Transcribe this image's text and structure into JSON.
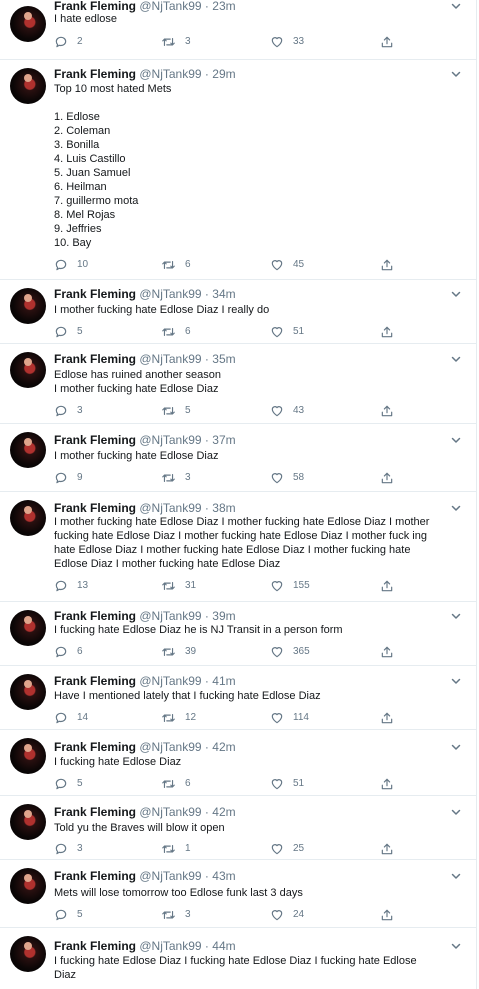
{
  "tweets": [
    {
      "name": "Frank Fleming",
      "handle": "@NjTank99",
      "sep": "·",
      "time": "23m",
      "text": "I hate edlose",
      "replies": "2",
      "retweets": "3",
      "likes": "33"
    },
    {
      "name": "Frank Fleming",
      "handle": "@NjTank99",
      "sep": "·",
      "time": "29m",
      "text": "Top 10 most hated Mets\n\n1. Edlose\n2. Coleman\n3. Bonilla\n4. Luis Castillo\n5. Juan Samuel\n6. Heilman\n7. guillermo mota\n8. Mel Rojas\n9. Jeffries\n10. Bay",
      "replies": "10",
      "retweets": "6",
      "likes": "45"
    },
    {
      "name": "Frank Fleming",
      "handle": "@NjTank99",
      "sep": "·",
      "time": "34m",
      "text": "I mother fucking hate Edlose Diaz I really do",
      "replies": "5",
      "retweets": "6",
      "likes": "51"
    },
    {
      "name": "Frank Fleming",
      "handle": "@NjTank99",
      "sep": "·",
      "time": "35m",
      "text": "Edlose has ruined another season\nI mother fucking hate Edlose Diaz",
      "replies": "3",
      "retweets": "5",
      "likes": "43"
    },
    {
      "name": "Frank Fleming",
      "handle": "@NjTank99",
      "sep": "·",
      "time": "37m",
      "text": "I mother fucking hate Edlose Diaz",
      "replies": "9",
      "retweets": "3",
      "likes": "58"
    },
    {
      "name": "Frank Fleming",
      "handle": "@NjTank99",
      "sep": "·",
      "time": "38m",
      "text": "I mother fucking hate Edlose Diaz I mother fucking hate Edlose Diaz I mother\nfucking hate Edlose Diaz I mother fucking hate Edlose Diaz I mother fuck ing\nhate Edlose Diaz I mother fucking hate Edlose Diaz I mother fucking hate\nEdlose Diaz I mother fucking hate Edlose Diaz",
      "replies": "13",
      "retweets": "31",
      "likes": "155"
    },
    {
      "name": "Frank Fleming",
      "handle": "@NjTank99",
      "sep": "·",
      "time": "39m",
      "text": "I fucking hate Edlose Diaz he is NJ Transit in a person form",
      "replies": "6",
      "retweets": "39",
      "likes": "365"
    },
    {
      "name": "Frank Fleming",
      "handle": "@NjTank99",
      "sep": "·",
      "time": "41m",
      "text": "Have I mentioned lately that I fucking hate Edlose Diaz",
      "replies": "14",
      "retweets": "12",
      "likes": "114"
    },
    {
      "name": "Frank Fleming",
      "handle": "@NjTank99",
      "sep": "·",
      "time": "42m",
      "text": "I fucking hate Edlose Diaz",
      "replies": "5",
      "retweets": "6",
      "likes": "51"
    },
    {
      "name": "Frank Fleming",
      "handle": "@NjTank99",
      "sep": "·",
      "time": "42m",
      "text": "Told yu the Braves will blow it open",
      "replies": "3",
      "retweets": "1",
      "likes": "25"
    },
    {
      "name": "Frank Fleming",
      "handle": "@NjTank99",
      "sep": "·",
      "time": "43m",
      "text": "Mets will lose tomorrow too Edlose funk last 3 days",
      "replies": "5",
      "retweets": "3",
      "likes": "24"
    },
    {
      "name": "Frank Fleming",
      "handle": "@NjTank99",
      "sep": "·",
      "time": "44m",
      "text": "I fucking hate Edlose Diaz I fucking hate Edlose Diaz I fucking hate Edlose\nDiaz",
      "replies": "",
      "retweets": "",
      "likes": ""
    }
  ],
  "icons": {
    "reply": "reply-icon",
    "retweet": "retweet-icon",
    "like": "like-icon",
    "share": "share-icon",
    "caret": "chevron-down-icon"
  },
  "colors": {
    "text": "#14171a",
    "secondary": "#657786",
    "divider": "#e6ecf0"
  }
}
